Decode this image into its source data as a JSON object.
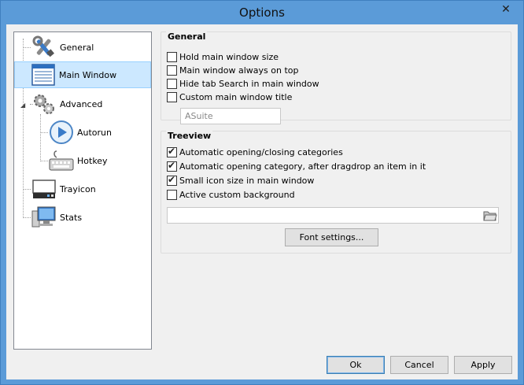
{
  "window": {
    "title": "Options",
    "close_glyph": "✕"
  },
  "tree": {
    "items": [
      {
        "label": "General",
        "icon": "tools-icon"
      },
      {
        "label": "Main Window",
        "icon": "window-icon",
        "selected": true
      },
      {
        "label": "Advanced",
        "icon": "gears-icon",
        "expanded": true
      },
      {
        "label": "Autorun",
        "icon": "play-icon"
      },
      {
        "label": "Hotkey",
        "icon": "keyboard-icon"
      },
      {
        "label": "Trayicon",
        "icon": "tray-icon"
      },
      {
        "label": "Stats",
        "icon": "monitor-icon"
      }
    ],
    "expander_glyph": "◢"
  },
  "general": {
    "title": "General",
    "options": [
      {
        "label": "Hold main window size",
        "checked": false
      },
      {
        "label": "Main window always on top",
        "checked": false
      },
      {
        "label": "Hide tab Search in main window",
        "checked": false
      },
      {
        "label": "Custom main window title",
        "checked": false
      }
    ],
    "title_field_value": "ASuite"
  },
  "treeview": {
    "title": "Treeview",
    "options": [
      {
        "label": "Automatic opening/closing categories",
        "checked": true
      },
      {
        "label": "Automatic opening category, after dragdrop an item in it",
        "checked": true
      },
      {
        "label": "Small icon size in main window",
        "checked": true
      },
      {
        "label": "Active custom background",
        "checked": false
      }
    ],
    "background_path": "",
    "font_button": "Font settings..."
  },
  "footer": {
    "ok": "Ok",
    "cancel": "Cancel",
    "apply": "Apply"
  }
}
